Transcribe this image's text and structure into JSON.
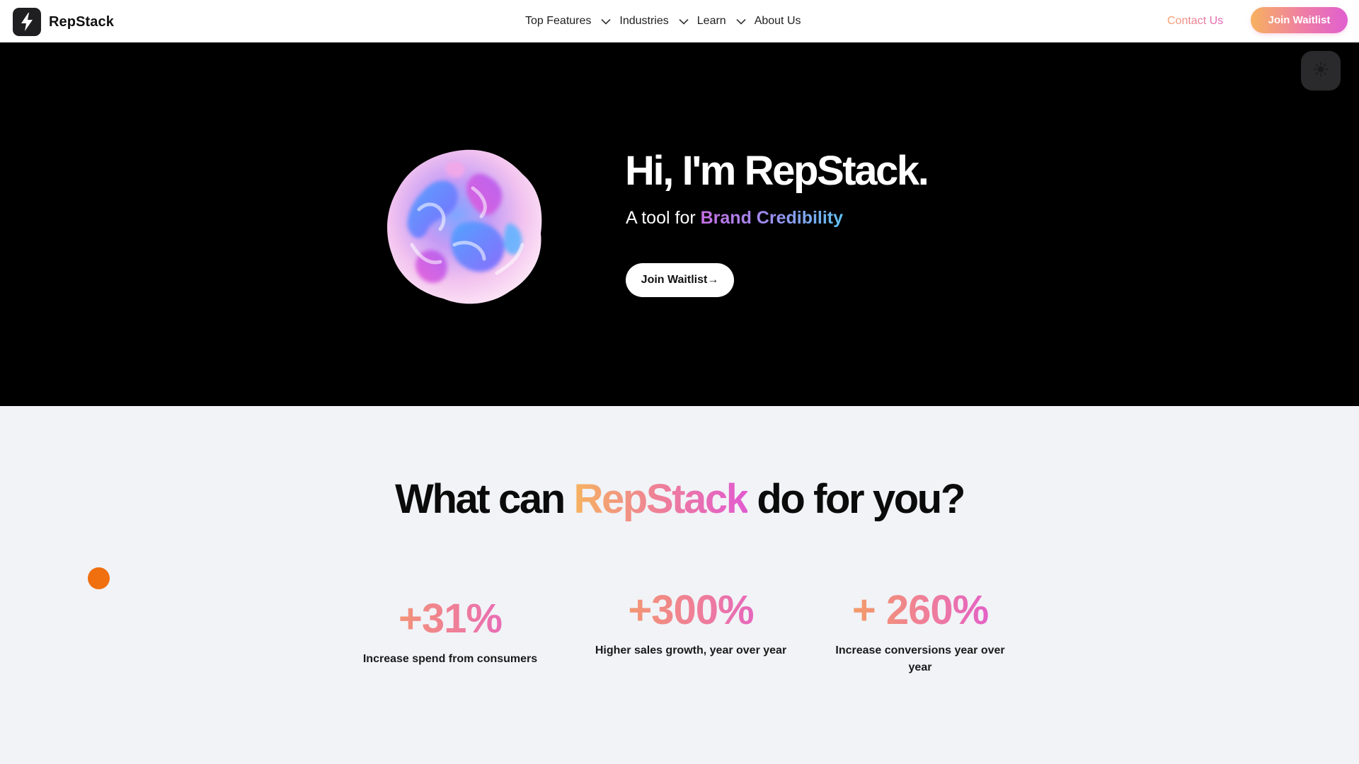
{
  "nav": {
    "brand": "RepStack",
    "menu": [
      {
        "label": "Top Features",
        "has_dropdown": true
      },
      {
        "label": "Industries",
        "has_dropdown": true
      },
      {
        "label": "Learn",
        "has_dropdown": true
      },
      {
        "label": "About Us",
        "has_dropdown": false
      }
    ],
    "contact_label": "Contact Us",
    "join_label": "Join Waitlist"
  },
  "hero": {
    "title": "Hi, I'm RepStack.",
    "subtitle_prefix": "A tool for ",
    "subtitle_accent": "Brand Credibility",
    "cta_label": "Join Waitlist→"
  },
  "features": {
    "title_prefix": "What can ",
    "title_accent": "RepStack",
    "title_suffix": " do for you?",
    "stats": [
      {
        "value": "+31%",
        "label": "Increase spend from consumers"
      },
      {
        "value": "+300%",
        "label": "Higher sales growth, year over year"
      },
      {
        "value": "+ 260%",
        "label": "Increase conversions year over year"
      }
    ]
  },
  "icons": {
    "brand_logo": "lightning-bolt-icon",
    "dropdown": "chevron-down-icon",
    "theme_toggle": "sun-icon",
    "hero_graphic": "iridescent-blob",
    "floating_dot": "orange-dot"
  },
  "colors": {
    "hero_bg": "#000000",
    "page_bg": "#f1f3f7",
    "accent_orange": "#f6b35f",
    "accent_pink": "#e25ad0",
    "dot": "#f06f0e"
  }
}
